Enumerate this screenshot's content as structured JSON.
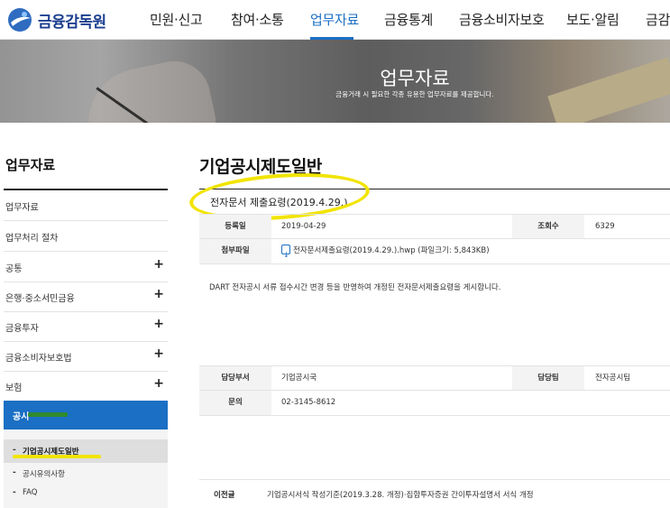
{
  "header": {
    "logo_text": "금융감독원",
    "menu": [
      "민원·신고",
      "참여·소통",
      "업무자료",
      "금융통계",
      "금융소비자보호",
      "보도·알림",
      "금감"
    ],
    "active_menu": "업무자료"
  },
  "banner": {
    "title": "업무자료",
    "subtitle": "금융거래 시 필요한 각종 유용한 업무자료를 제공합니다."
  },
  "sidebar": {
    "title": "업무자료",
    "items": [
      {
        "label": "업무자료",
        "expandable": false
      },
      {
        "label": "업무처리 절차",
        "expandable": false
      },
      {
        "label": "공통",
        "expandable": true
      },
      {
        "label": "은행·중소서민금융",
        "expandable": true
      },
      {
        "label": "금융투자",
        "expandable": true
      },
      {
        "label": "금융소비자보호법",
        "expandable": true
      },
      {
        "label": "보험",
        "expandable": true
      }
    ],
    "plus_symbol": "+",
    "active_section": "공시",
    "sub_items": [
      {
        "label": "기업공시제도일반",
        "selected": true
      },
      {
        "label": "공시유의사항",
        "selected": false
      },
      {
        "label": "FAQ",
        "selected": false
      }
    ],
    "sub_dash": "-"
  },
  "content": {
    "page_title": "기업공시제도일반",
    "post_title": "전자문서 제출요령(2019.4.29.)",
    "meta": {
      "date_label": "등록일",
      "date_value": "2019-04-29",
      "views_label": "조회수",
      "views_value": "6329",
      "file_label": "첨부파일",
      "file_value": "전자문서제출요령(2019.4.29.).hwp (파일크기: 5,843KB)"
    },
    "body": "DART 전자공시 서류 접수시간 변경 등을 반영하여 개정된 전자문서제출요령을 게시합니다.",
    "dept": {
      "dept_label": "담당부서",
      "dept_value": "기업공시국",
      "team_label": "담당팀",
      "team_value": "전자공시팀",
      "contact_label": "문의",
      "contact_value": "02-3145-8612"
    },
    "prev": {
      "label": "이전글",
      "title": "기업공시서식 작성기준(2019.3.28. 개정)·집합투자증권 간이투자설명서 서식 개정"
    }
  },
  "colors": {
    "brand_blue": "#1b6fc4",
    "highlight_yellow": "#f2e400",
    "marker_green": "#2f8a2f"
  }
}
